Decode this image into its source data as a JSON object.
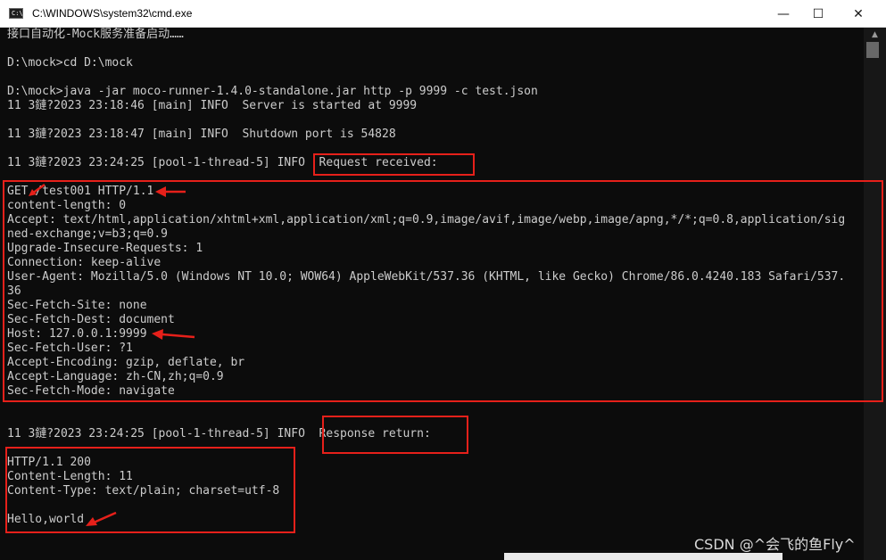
{
  "window": {
    "title": "C:\\WINDOWS\\system32\\cmd.exe",
    "icon_label": "C:\\",
    "minimize_glyph": "—",
    "maximize_glyph": "☐",
    "close_glyph": "✕"
  },
  "console_lines": [
    "接口自动化-Mock服务准备启动……",
    "",
    "D:\\mock>cd D:\\mock",
    "",
    "D:\\mock>java -jar moco-runner-1.4.0-standalone.jar http -p 9999 -c test.json",
    "11 3鏈?2023 23:18:46 [main] INFO  Server is started at 9999",
    "",
    "11 3鏈?2023 23:18:47 [main] INFO  Shutdown port is 54828",
    "",
    "11 3鏈?2023 23:24:25 [pool-1-thread-5] INFO  Request received:",
    "",
    "GET /test001 HTTP/1.1",
    "content-length: 0",
    "Accept: text/html,application/xhtml+xml,application/xml;q=0.9,image/avif,image/webp,image/apng,*/*;q=0.8,application/sig",
    "ned-exchange;v=b3;q=0.9",
    "Upgrade-Insecure-Requests: 1",
    "Connection: keep-alive",
    "User-Agent: Mozilla/5.0 (Windows NT 10.0; WOW64) AppleWebKit/537.36 (KHTML, like Gecko) Chrome/86.0.4240.183 Safari/537.",
    "36",
    "Sec-Fetch-Site: none",
    "Sec-Fetch-Dest: document",
    "Host: 127.0.0.1:9999",
    "Sec-Fetch-User: ?1",
    "Accept-Encoding: gzip, deflate, br",
    "Accept-Language: zh-CN,zh;q=0.9",
    "Sec-Fetch-Mode: navigate",
    "",
    "",
    "11 3鏈?2023 23:24:25 [pool-1-thread-5] INFO  Response return:",
    "",
    "HTTP/1.1 200",
    "Content-Length: 11",
    "Content-Type: text/plain; charset=utf-8",
    "",
    "Hello,world"
  ],
  "scrollbar": {
    "up_glyph": "▲"
  },
  "watermark": "CSDN @^会飞的鱼Fly^",
  "colors": {
    "annotation": "#e6201a",
    "console_text": "#cccccc",
    "console_bg": "#0c0c0c"
  }
}
